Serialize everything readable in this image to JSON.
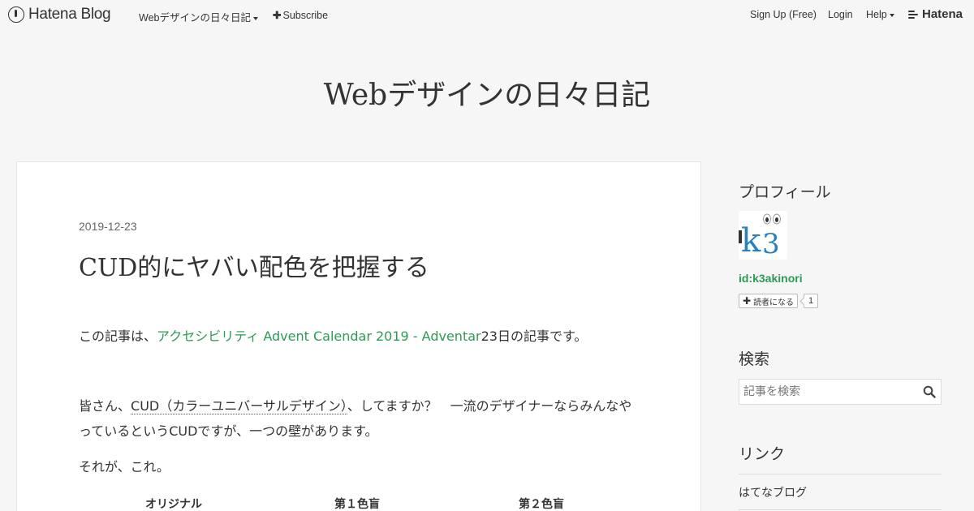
{
  "navbar": {
    "brand": "Hatena Blog",
    "blog_menu": "Webデザインの日々日記",
    "subscribe": "Subscribe",
    "signup": "Sign Up (Free)",
    "login": "Login",
    "help": "Help",
    "hatena": "Hatena"
  },
  "blog": {
    "title": "Webデザインの日々日記"
  },
  "entry": {
    "date": "2019-12-23",
    "title": "CUD的にヤバい配色を把握する",
    "p1_before": "この記事は、",
    "p1_link": "アクセシビリティ Advent Calendar 2019 - Adventar",
    "p1_after": "23日の記事です。",
    "p2_before": "皆さん、",
    "p2_cud": "CUD（カラーユニバーサルデザイン）",
    "p2_after": "、してますか？　一流のデザイナーならみんなやっているというCUDですが、一つの壁があります。",
    "p3": "それが、これ。",
    "columns": [
      "オリジナル",
      "第１色盲",
      "第２色盲"
    ]
  },
  "sidebar": {
    "profile_heading": "プロフィール",
    "profile_id": "id:k3akinori",
    "subscribe_label": "読者になる",
    "subscriber_count": "1",
    "search_heading": "検索",
    "search_placeholder": "記事を検索",
    "links_heading": "リンク",
    "links": [
      "はてなブログ"
    ]
  },
  "colors": {
    "accent_green": "#2c9a54",
    "avatar_blue": "#2a7fbf"
  }
}
